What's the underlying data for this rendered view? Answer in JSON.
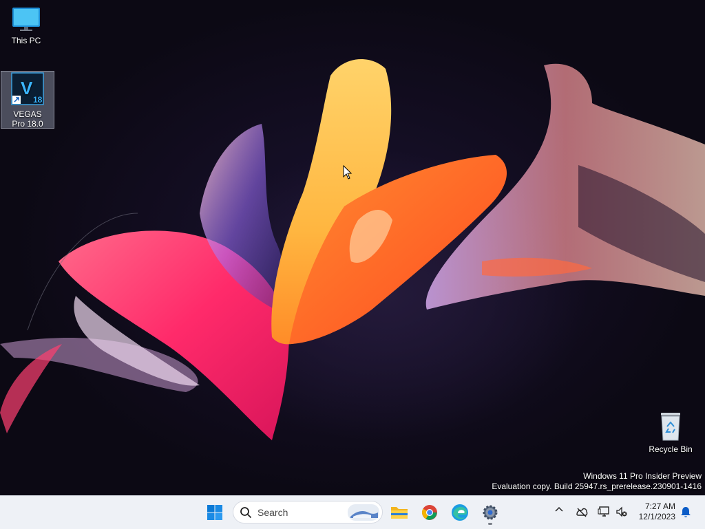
{
  "desktop": {
    "icons": [
      {
        "label": "This PC",
        "icon": "this-pc-icon"
      },
      {
        "label": "VEGAS Pro 18.0",
        "icon": "vegas-pro-icon",
        "badge": "18",
        "letter": "V",
        "selected": true
      },
      {
        "label": "Recycle Bin",
        "icon": "recycle-bin-icon"
      }
    ],
    "watermark": {
      "line1": "Windows 11 Pro Insider Preview",
      "line2": "Evaluation copy. Build 25947.rs_prerelease.230901-1416"
    }
  },
  "taskbar": {
    "search_placeholder": "Search",
    "apps": [
      {
        "icon": "start-icon"
      },
      {
        "icon": "file-explorer-icon"
      },
      {
        "icon": "chrome-icon"
      },
      {
        "icon": "edge-icon"
      },
      {
        "icon": "settings-icon",
        "running": true
      }
    ],
    "tray": {
      "icons": [
        "chevron-up-icon",
        "network-offline-icon",
        "display-icon",
        "volume-muted-icon",
        "notification-bell-icon"
      ]
    },
    "clock": {
      "time": "7:27 AM",
      "date": "12/1/2023"
    }
  },
  "colors": {
    "accent": "#0067c0",
    "taskbar_bg": "#eef1f6",
    "desktop_bg": "#0e0a18"
  }
}
